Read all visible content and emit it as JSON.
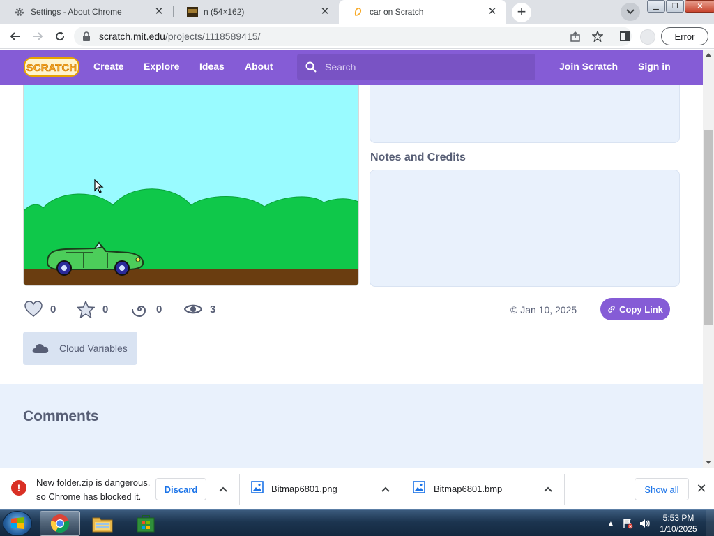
{
  "browser": {
    "tabs": [
      {
        "title": "Settings - About Chrome",
        "icon": "gear-icon"
      },
      {
        "title": "n (54×162)",
        "icon": "image-thumbnail-icon"
      },
      {
        "title": "car on Scratch",
        "icon": "scratch-cat-icon",
        "active": true
      }
    ],
    "address": {
      "host": "scratch.mit.edu",
      "path": "/projects/1118589415/"
    },
    "error_button": "Error"
  },
  "scratch_nav": {
    "logo_text": "SCRATCH",
    "links": [
      "Create",
      "Explore",
      "Ideas",
      "About"
    ],
    "search_placeholder": "Search",
    "join": "Join Scratch",
    "signin": "Sign in"
  },
  "project": {
    "notes_heading": "Notes and Credits",
    "stats": {
      "loves": "0",
      "favorites": "0",
      "remixes": "0",
      "views": "3"
    },
    "date": "© Jan 10, 2025",
    "copy_link": "Copy Link",
    "cloud_variables": "Cloud Variables",
    "comments_heading": "Comments"
  },
  "download_shelf": {
    "warning_line1": "New folder.zip is dangerous,",
    "warning_line2": "so Chrome has blocked it.",
    "discard": "Discard",
    "files": [
      "Bitmap6801.png",
      "Bitmap6801.bmp"
    ],
    "show_all": "Show all"
  },
  "taskbar": {
    "apps": [
      "chrome-icon",
      "file-explorer-icon",
      "store-icon"
    ],
    "time": "5:53 PM",
    "date": "1/10/2025"
  },
  "colors": {
    "scratch_purple": "#855cd6",
    "sky": "#99fbff",
    "grass": "#0fc84a",
    "ground": "#6a3d10"
  }
}
